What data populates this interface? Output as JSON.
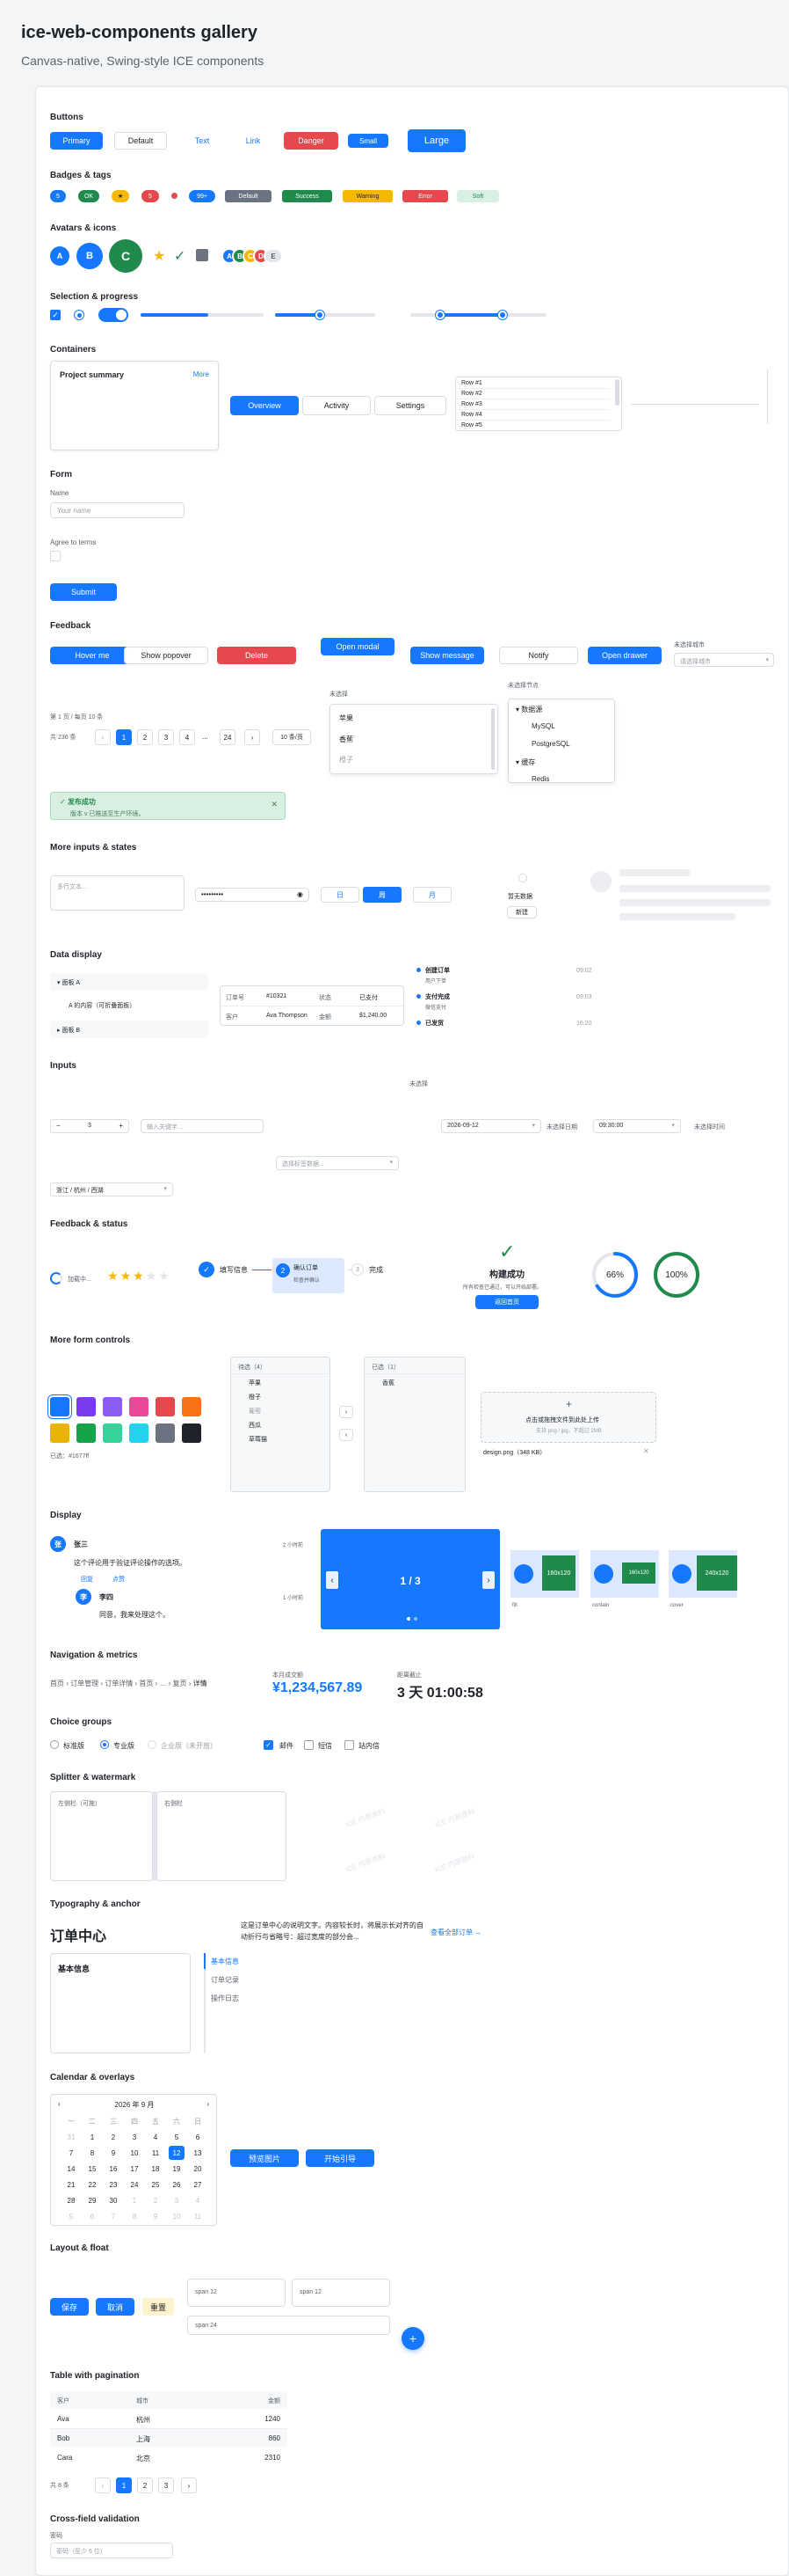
{
  "header": {
    "title": "ice-web-components gallery",
    "subtitle": "Canvas-native, Swing-style ICE components"
  },
  "sections": {
    "buttons": "Buttons",
    "badges": "Badges & tags",
    "avatars": "Avatars & icons",
    "selection": "Selection & progress",
    "containers": "Containers",
    "form": "Form",
    "feedback": "Feedback",
    "more_inputs": "More inputs & states",
    "data_display": "Data display",
    "inputs": "Inputs",
    "feedback_status": "Feedback & status",
    "more_form": "More form controls",
    "display": "Display",
    "nav_metrics": "Navigation & metrics",
    "choice": "Choice groups",
    "splitter": "Splitter & watermark",
    "typography": "Typography & anchor",
    "calendar": "Calendar & overlays",
    "layout": "Layout & float",
    "table": "Table with pagination",
    "cross": "Cross-field validation"
  },
  "buttons": [
    "Primary",
    "Default",
    "Text",
    "Link",
    "Danger",
    "Small",
    "Large"
  ],
  "badges": {
    "counts": [
      "5",
      "OK",
      "★",
      "5",
      "99+"
    ],
    "tags": [
      "Default",
      "Success",
      "Warning",
      "Error",
      "Soft"
    ],
    "colors": {
      "blue": "#1677ff",
      "green": "#1f8a4c",
      "amber": "#f5b800",
      "red": "#e5484d",
      "gray": "#6b7280",
      "soft": "#d9efe1"
    }
  },
  "avatars": {
    "letters": [
      "A",
      "B",
      "C"
    ],
    "group": [
      "A",
      "B",
      "C",
      "D",
      "E"
    ],
    "icons": [
      "star-icon",
      "check-icon",
      "lock-icon"
    ]
  },
  "selection": {
    "progress": 0.55,
    "slider": 0.45,
    "range": [
      0.22,
      0.68
    ]
  },
  "containers": {
    "card_title": "Project summary",
    "card_link": "More",
    "tabs": [
      "Overview",
      "Activity",
      "Settings"
    ],
    "rows": [
      "Row #1",
      "Row #2",
      "Row #3",
      "Row #4",
      "Row #5"
    ]
  },
  "form": {
    "name_label": "Name",
    "name_placeholder": "Your name",
    "agree_label": "Agree to terms",
    "submit": "Submit"
  },
  "feedback": {
    "hover": "Hover me",
    "popover": "Show popover",
    "delete": "Delete",
    "modal": "Open modal",
    "message": "Show message",
    "notify": "Notify",
    "drawer": "Open drawer",
    "city_label": "未选择城市",
    "city_placeholder": "请选择城市",
    "pager_info": "第 1 页 / 每页 10 条",
    "pager_total": "共 236 条",
    "pager_pages": [
      "1",
      "2",
      "3",
      "4",
      "...",
      "24"
    ],
    "pager_size": "10 条/页",
    "select_label": "未选择",
    "select_options": [
      "苹果",
      "香蕉",
      "橙子"
    ],
    "tree_label": "未选择节点",
    "tree_nodes": [
      "数据源",
      "MySQL",
      "PostgreSQL",
      "缓存",
      "Redis"
    ],
    "alert_title": "发布成功",
    "alert_body": "版本 v 已推送至生产环境。"
  },
  "more_inputs": {
    "textarea_placeholder": "多行文本...",
    "password": "•••••••••",
    "segments": [
      "日",
      "周",
      "月"
    ],
    "empty_title": "暂无数据",
    "empty_button": "新建"
  },
  "data_display": {
    "collapse": [
      "面板 A",
      "A 的内容（可折叠面板）",
      "面板 B"
    ],
    "desc": [
      [
        "订单号",
        "#10321",
        "状态",
        "已支付"
      ],
      [
        "客户",
        "Ava Thompson",
        "金额",
        "$1,240.00"
      ]
    ],
    "timeline": [
      {
        "title": "创建订单",
        "sub": "用户下单",
        "time": "09:02"
      },
      {
        "title": "支付完成",
        "sub": "微信支付",
        "time": "09:03"
      },
      {
        "title": "已发货",
        "sub": "",
        "time": "16:20"
      }
    ]
  },
  "inputs": {
    "top_label": "未选择",
    "stepper": "3",
    "search_placeholder": "输入关键字…",
    "date": "2026-09-12",
    "date_label": "未选择日期",
    "time": "09:30:00",
    "time_label": "未选择时间",
    "multi_placeholder": "选择标签数据...",
    "cascader": "浙江 / 杭州 / 西湖"
  },
  "feedback_status": {
    "loading": "加载中...",
    "rating": 3,
    "steps": [
      {
        "title": "填写信息",
        "sub": ""
      },
      {
        "title": "确认订单",
        "sub": "检查并确认"
      },
      {
        "title": "完成",
        "sub": ""
      }
    ],
    "result_title": "构建成功",
    "result_body": "所有检查已通过，可以开始部署。",
    "result_button": "返回首页",
    "progress_a": "66%",
    "progress_b": "100%",
    "progress_a_value": 0.66
  },
  "more_form": {
    "colors": [
      "#1677ff",
      "#7c3aed",
      "#8b5cf6",
      "#ec4899",
      "#e5484d",
      "#f97316",
      "#eab308",
      "#16a34a",
      "#34d399",
      "#22d3ee",
      "#6b7280",
      "#1f2329"
    ],
    "selected_color": "#1677ff",
    "color_label": "已选：#1677ff",
    "transfer_left_title": "待选（4）",
    "transfer_left": [
      "苹果",
      "橙子",
      "葡萄",
      "西瓜",
      "草莓猫"
    ],
    "transfer_right_title": "已选（1）",
    "transfer_right": [
      "香蕉"
    ],
    "upload_title": "点击或拖拽文件到此处上传",
    "upload_hint": "支持 png / jpg，不超过 2MB",
    "upload_file": "design.png（348 KB）"
  },
  "display": {
    "comment_author": "张三",
    "comment_time": "2 小时前",
    "comment_text": "这个评论用于验证评论操作的选项。",
    "comment_actions": [
      "回复",
      "点赞"
    ],
    "reply_author": "李四",
    "reply_time": "1 小时前",
    "reply_text": "同意，我来处理这个。",
    "carousel": "1 / 3",
    "thumb_labels": [
      "fill",
      "contain",
      "cover"
    ],
    "thumb_captions": [
      "160x120",
      "160x120",
      "240x120"
    ]
  },
  "nav_metrics": {
    "breadcrumb": [
      "首页",
      "订单管理",
      "订单详情",
      "首页",
      "…",
      "复页",
      "详情"
    ],
    "stat_label": "本月成交额",
    "stat_value": "¥1,234,567.89",
    "count_label": "距离截止",
    "count_value": "3 天 01:00:58"
  },
  "choice": {
    "radios": [
      "标准版",
      "专业版",
      "企业版（未开放）"
    ],
    "checks": [
      "邮件",
      "短信",
      "站内信"
    ]
  },
  "splitter": {
    "left": "左侧栏（可拖）",
    "right": "右侧栏",
    "watermark": "ICE 内部资料"
  },
  "typography": {
    "title": "订单中心",
    "para": "这是订单中心的说明文字。内容较长时，将展示长对齐的自动折行与省略号：超过宽度的部分会...",
    "link": "查看全部订单 →",
    "card_title": "基本信息",
    "anchor": [
      "基本信息",
      "订单记录",
      "操作日志"
    ]
  },
  "calendar": {
    "title": "2026 年 9 月",
    "weekdays": [
      "一",
      "二",
      "三",
      "四",
      "五",
      "六",
      "日"
    ],
    "days": [
      "31",
      "1",
      "2",
      "3",
      "4",
      "5",
      "6",
      "7",
      "8",
      "9",
      "10",
      "11",
      "12",
      "13",
      "14",
      "15",
      "16",
      "17",
      "18",
      "19",
      "20",
      "21",
      "22",
      "23",
      "24",
      "25",
      "26",
      "27",
      "28",
      "29",
      "30",
      "1",
      "2",
      "3",
      "4",
      "5",
      "6",
      "7",
      "8",
      "9",
      "10",
      "11"
    ],
    "selected": "12",
    "preview": "预览图片",
    "tour": "开始引导"
  },
  "layout": {
    "buttons": [
      "保存",
      "取消",
      "重置"
    ],
    "spans": [
      "span 12",
      "span 12",
      "span 24"
    ],
    "float": "+"
  },
  "table": {
    "headers": [
      "客户",
      "城市",
      "金额"
    ],
    "rows": [
      [
        "Ava",
        "杭州",
        "1240"
      ],
      [
        "Bob",
        "上海",
        "860"
      ],
      [
        "Cara",
        "北京",
        "2310"
      ]
    ],
    "total": "共 8 条",
    "pages": [
      "1",
      "2",
      "3"
    ]
  },
  "cross": {
    "label": "密码",
    "placeholder": "密码（至少 6 位）"
  }
}
